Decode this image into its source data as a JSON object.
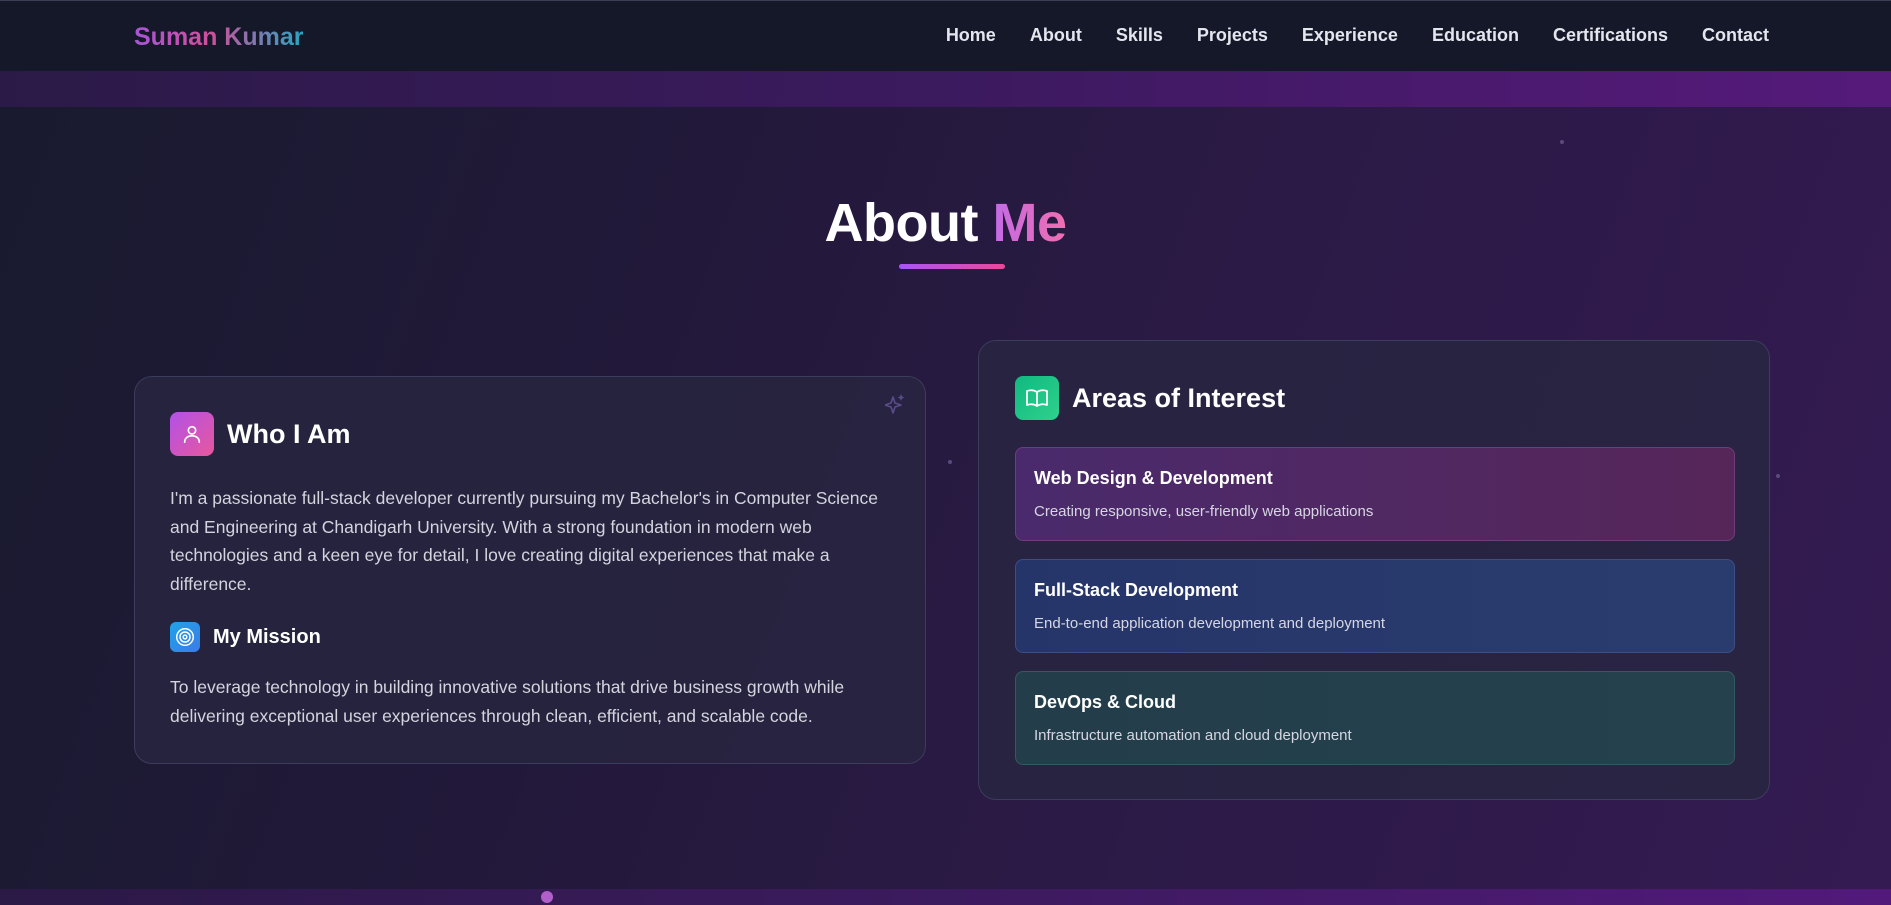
{
  "navbar": {
    "logo": "Suman Kumar",
    "links": [
      "Home",
      "About",
      "Skills",
      "Projects",
      "Experience",
      "Education",
      "Certifications",
      "Contact"
    ]
  },
  "section": {
    "title_part1": "About",
    "title_part2": "Me"
  },
  "who_i_am": {
    "title": "Who I Am",
    "icon": "user-icon",
    "paragraph": "I'm a passionate full-stack developer currently pursuing my Bachelor's in Computer Science and Engineering at Chandigarh University. With a strong foundation in modern web technologies and a keen eye for detail, I love creating digital experiences that make a difference.",
    "mission_title": "My Mission",
    "mission_icon": "target-icon",
    "mission_text": "To leverage technology in building innovative solutions that drive business growth while delivering exceptional user experiences through clean, efficient, and scalable code."
  },
  "areas": {
    "title": "Areas of Interest",
    "icon": "book-icon",
    "items": [
      {
        "title": "Web Design & Development",
        "desc": "Creating responsive, user-friendly web applications"
      },
      {
        "title": "Full-Stack Development",
        "desc": "End-to-end application development and deployment"
      },
      {
        "title": "DevOps & Cloud",
        "desc": "Infrastructure automation and cloud deployment"
      }
    ]
  },
  "colors": {
    "accent_purple": "#a855f7",
    "accent_pink": "#ec4899",
    "accent_green": "#10b981",
    "nav_bg": "#141829"
  }
}
